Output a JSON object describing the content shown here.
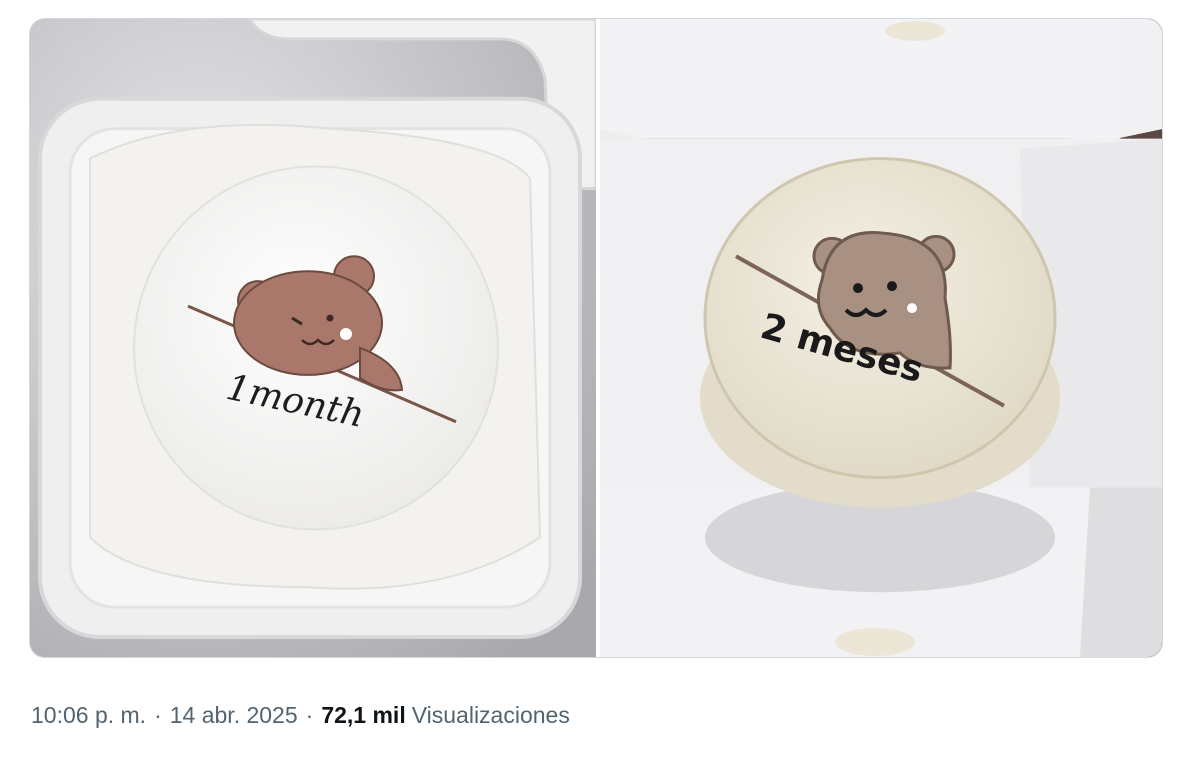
{
  "post": {
    "images": [
      {
        "alt": "",
        "cake_text": "1month"
      },
      {
        "alt": "",
        "cake_text": "2 meses"
      }
    ],
    "meta": {
      "time": "10:06 p. m.",
      "separator": "·",
      "date": "14 abr. 2025",
      "views_count": "72,1 mil",
      "views_label": "Visualizaciones"
    }
  },
  "colors": {
    "border": "#cfd9de",
    "secondary_text": "#536471",
    "primary_text": "#0f1419"
  }
}
